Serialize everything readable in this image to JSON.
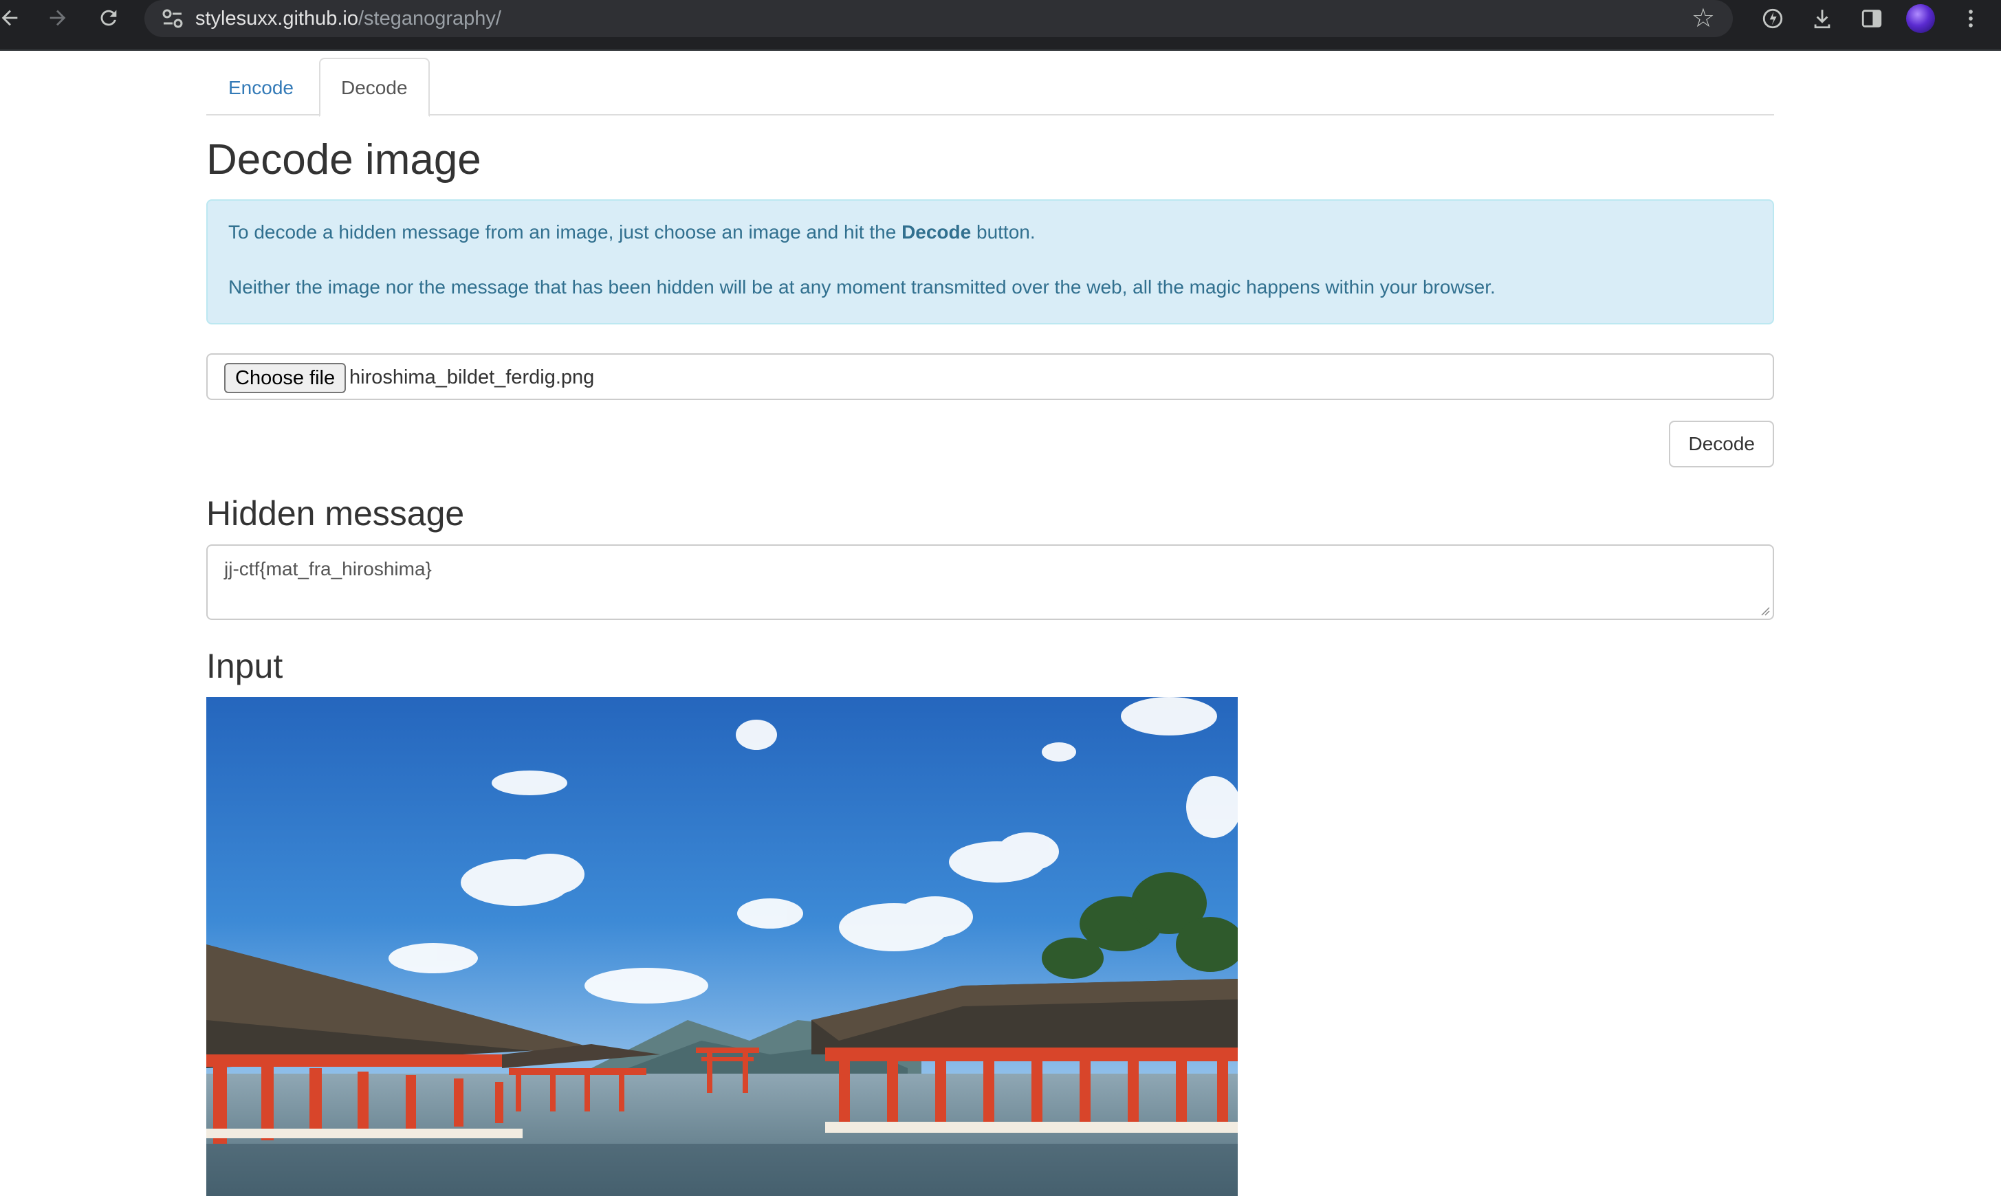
{
  "browser": {
    "back_icon": "arrow-left-icon",
    "forward_icon": "arrow-right-icon",
    "reload_icon": "reload-icon",
    "url_host": "stylesuxx.github.io",
    "url_path": "/steganography/",
    "bookmark_icon": "star-icon",
    "toolbar_icons": [
      "extension-icon",
      "download-icon",
      "side-panel-icon",
      "profile-avatar",
      "menu-icon"
    ]
  },
  "tabs": [
    {
      "label": "Encode",
      "active": false
    },
    {
      "label": "Decode",
      "active": true
    }
  ],
  "page": {
    "title": "Decode image",
    "info": {
      "line1_before": "To decode a hidden message from an image, just choose an image and hit the ",
      "line1_bold": "Decode",
      "line1_after": " button.",
      "line2": "Neither the image nor the message that has been hidden will be at any moment transmitted over the web, all the magic happens within your browser."
    },
    "file_input": {
      "button_label": "Choose file",
      "file_name": "hiroshima_bildet_ferdig.png"
    },
    "decode_button": "Decode",
    "hidden_message_heading": "Hidden message",
    "hidden_message_value": "jj-ctf{mat_fra_hiroshima}",
    "input_heading": "Input"
  },
  "colors": {
    "link": "#337ab7",
    "info_bg": "#d9edf7",
    "info_border": "#bce8f1",
    "info_text": "#31708f",
    "torii_red": "#d8452a"
  }
}
